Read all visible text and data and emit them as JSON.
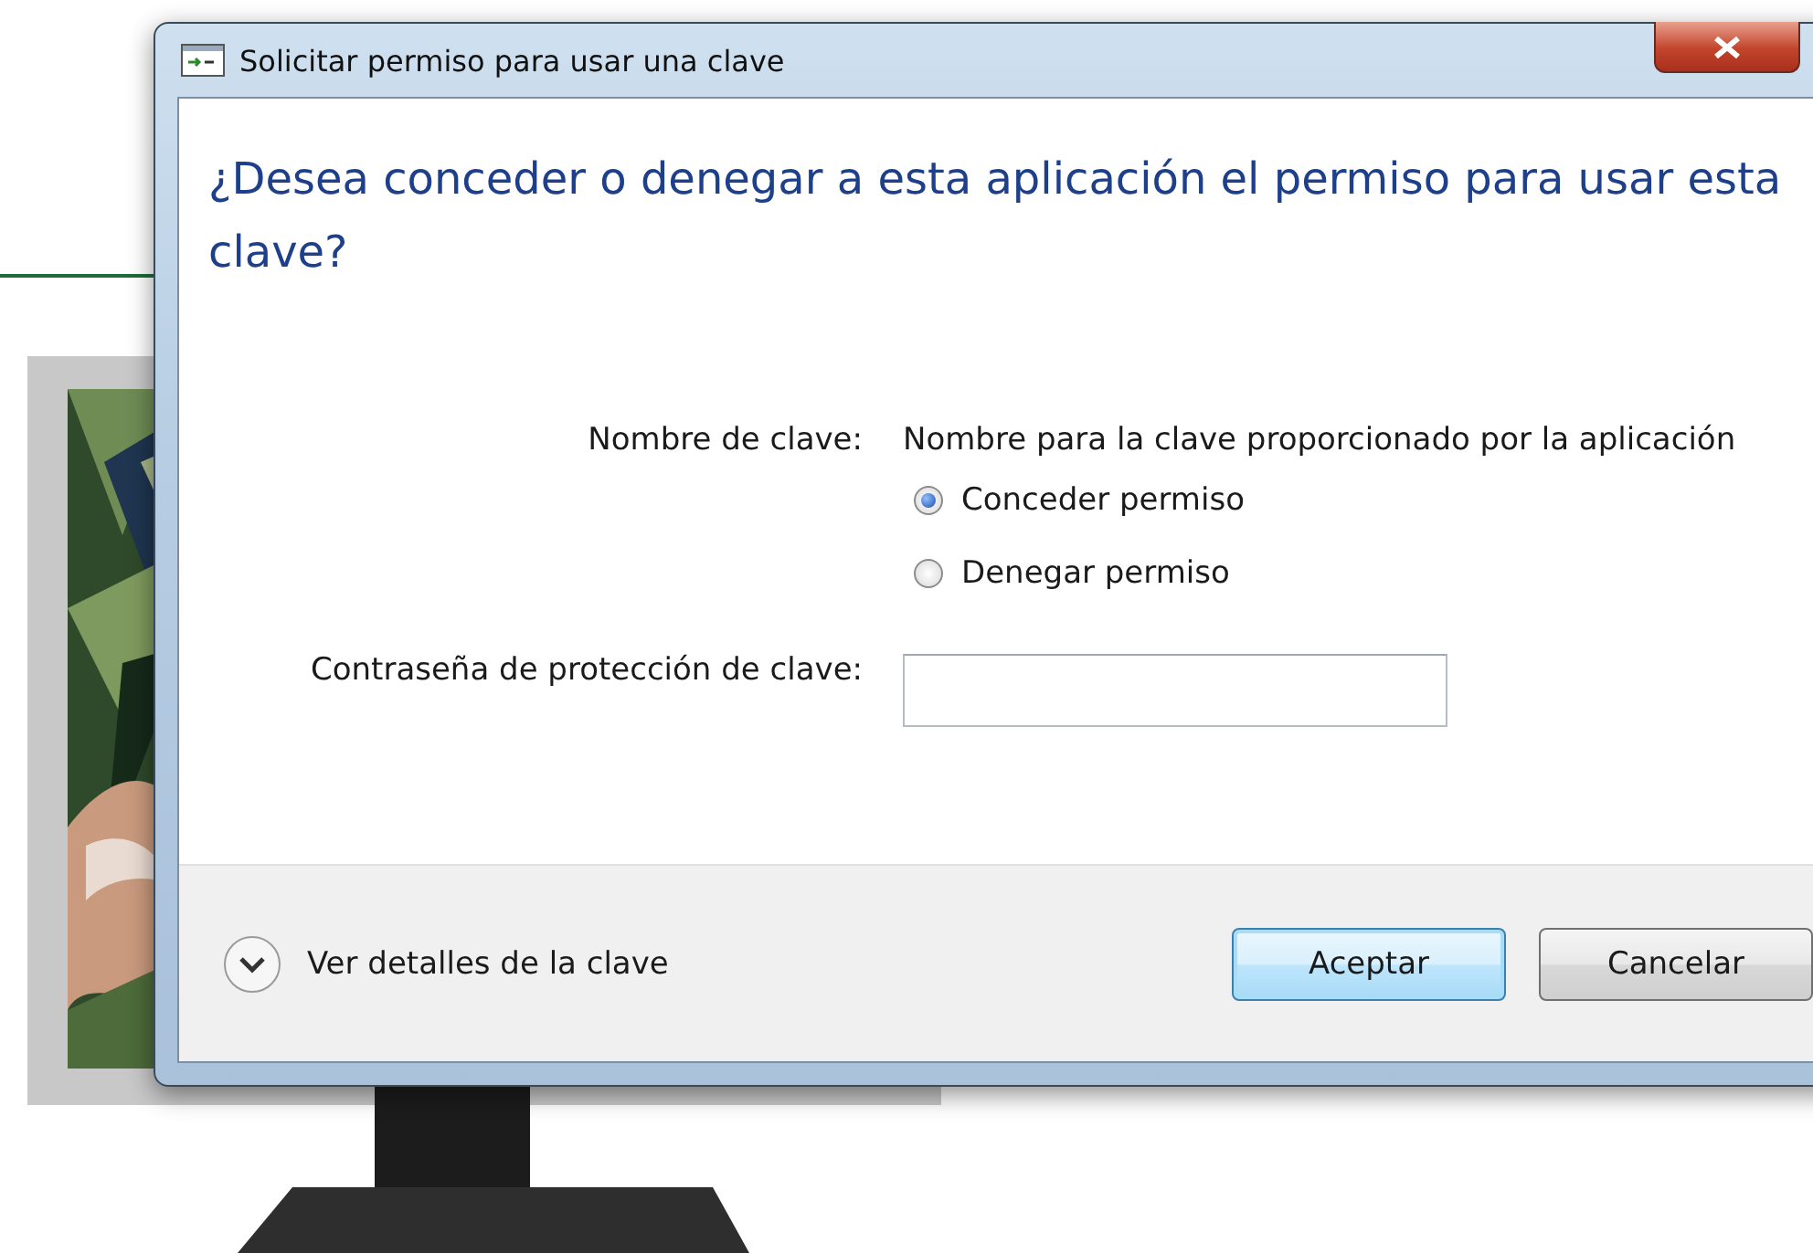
{
  "window": {
    "title": "Solicitar permiso para usar una clave"
  },
  "heading": "¿Desea conceder o denegar a esta aplicación el permiso para usar esta clave?",
  "key_name": {
    "label": "Nombre de clave:",
    "value": "Nombre para la clave proporcionado por la aplicación"
  },
  "permissions": [
    {
      "label": "Conceder permiso",
      "selected": true
    },
    {
      "label": "Denegar permiso",
      "selected": false
    }
  ],
  "password": {
    "label": "Contraseña de protección de clave:"
  },
  "details_toggle": {
    "label": "Ver detalles de la clave",
    "expanded": false
  },
  "buttons": [
    {
      "label": "Aceptar",
      "default": true
    },
    {
      "label": "Cancelar",
      "default": false
    }
  ]
}
